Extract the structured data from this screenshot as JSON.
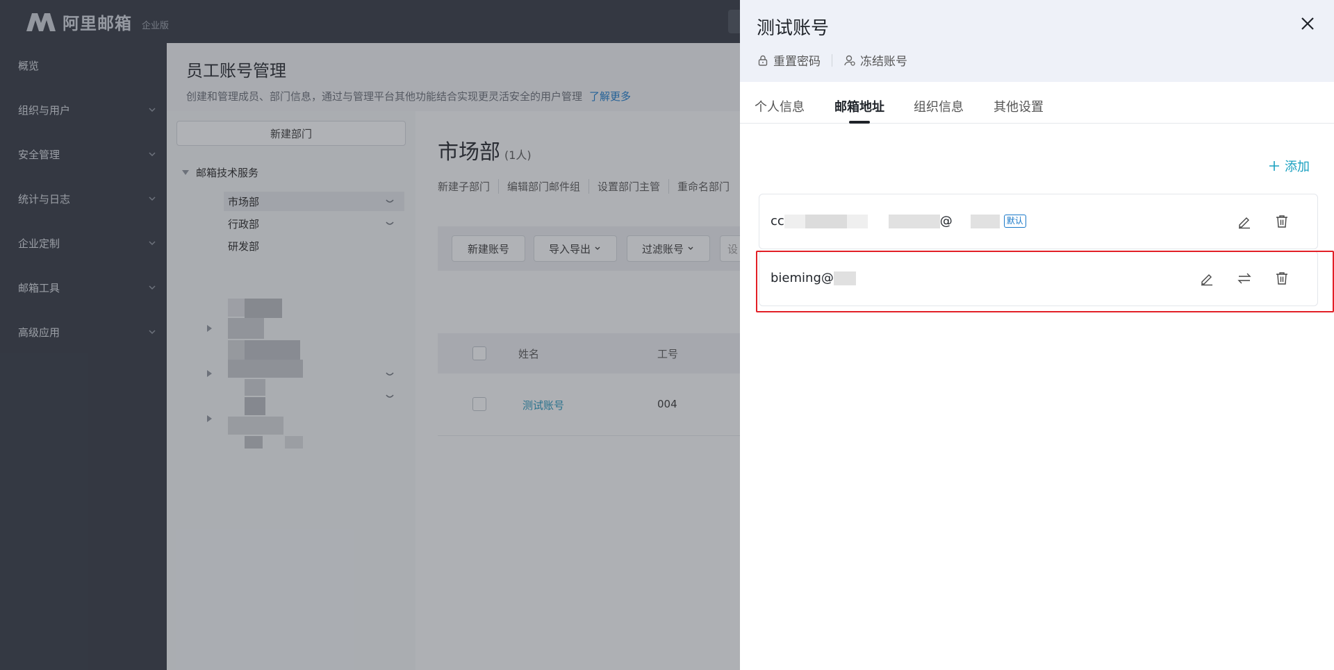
{
  "header": {
    "logo_text": "阿里邮箱",
    "edition": "企业版"
  },
  "sidebar": {
    "items": [
      {
        "label": "概览"
      },
      {
        "label": "组织与用户"
      },
      {
        "label": "安全管理"
      },
      {
        "label": "统计与日志"
      },
      {
        "label": "企业定制"
      },
      {
        "label": "邮箱工具"
      },
      {
        "label": "高级应用"
      }
    ]
  },
  "page": {
    "title": "员工账号管理",
    "description": "创建和管理成员、部门信息，通过与管理平台其他功能结合实现更灵活安全的用户管理",
    "learn_more": "了解更多"
  },
  "tree": {
    "new_dept_label": "新建部门",
    "root": "邮箱技术服务",
    "nodes": [
      "市场部",
      "行政部",
      "研发部"
    ]
  },
  "dept": {
    "name": "市场部",
    "count": "(1人)",
    "actions": [
      "新建子部门",
      "编辑部门邮件组",
      "设置部门主管",
      "重命名部门"
    ]
  },
  "toolbar": {
    "new_account": "新建账号",
    "import_export": "导入导出",
    "filter": "过滤账号",
    "truncated": "设"
  },
  "table": {
    "headers": [
      "姓名",
      "工号"
    ],
    "rows": [
      {
        "name": "测试账号",
        "id": "004"
      }
    ]
  },
  "drawer": {
    "title": "测试账号",
    "reset_password": "重置密码",
    "freeze_account": "冻结账号",
    "tabs": [
      "个人信息",
      "邮箱地址",
      "组织信息",
      "其他设置"
    ],
    "active_tab": "邮箱地址",
    "add_label": "添加",
    "addresses": [
      {
        "prefix": "cc",
        "at": "@",
        "badge": "默认"
      },
      {
        "prefix": "bieming@"
      }
    ]
  },
  "colors": {
    "accent": "#1aa0c0",
    "highlight": "#e21f26",
    "sidebar_bg": "#2f3540"
  }
}
